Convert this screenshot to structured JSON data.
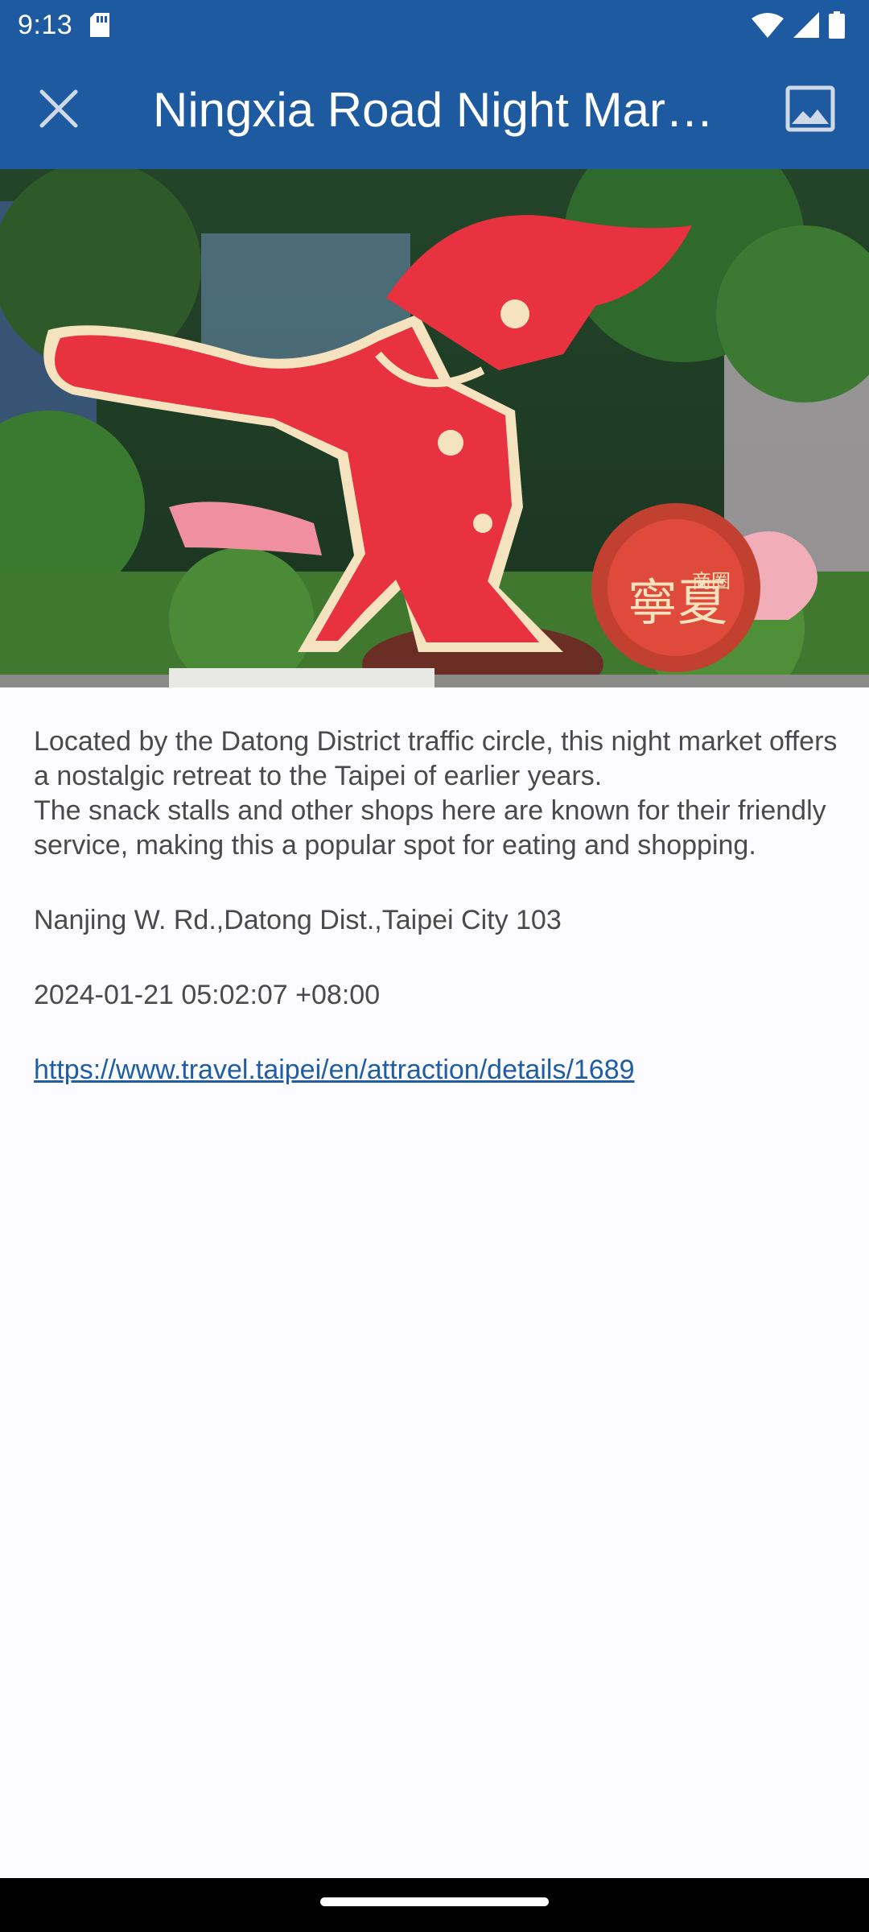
{
  "status_bar": {
    "time": "9:13",
    "icons": [
      "sd-card-icon",
      "wifi-icon",
      "signal-icon",
      "battery-icon"
    ]
  },
  "app_bar": {
    "title": "Ningxia Road Night Mar…",
    "close_icon": "close-icon",
    "image_icon": "image-icon",
    "background": "#1E5AA0"
  },
  "content": {
    "description": "Located by the Datong District traffic circle, this night market offers a nostalgic retreat to the Taipei of earlier years.\nThe snack stalls and other shops here are known for their friendly service, making this a popular spot for eating and shopping.",
    "address": "Nanjing W. Rd.,Datong Dist.,Taipei City 103",
    "datetime": "2024-01-21 05:02:07 +08:00",
    "link": "https://www.travel.taipei/en/attraction/details/1689"
  },
  "hero_sign_text": [
    "寧夏",
    "商圈"
  ],
  "colors": {
    "link": "#1F5EA4",
    "text": "#4A4A4A",
    "page_bg": "#FCFBFF"
  }
}
